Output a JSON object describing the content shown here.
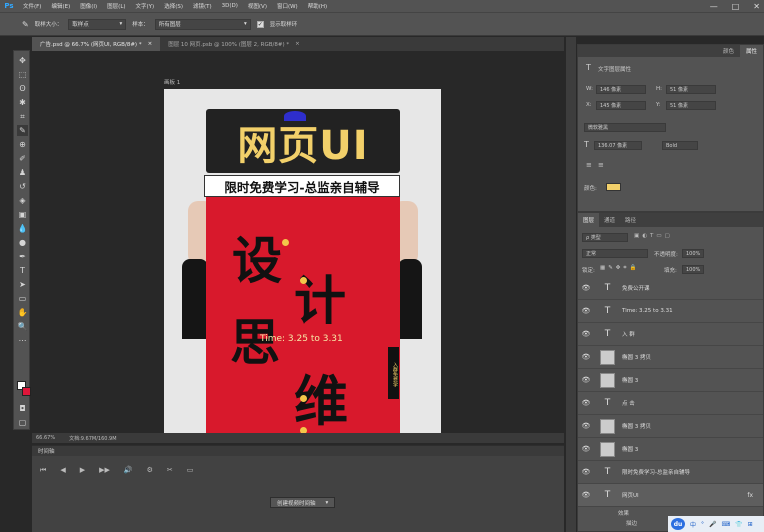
{
  "app": {
    "logo": "Ps",
    "menu": [
      "文件(F)",
      "编辑(E)",
      "图像(I)",
      "图层(L)",
      "文字(Y)",
      "选择(S)",
      "滤镜(T)",
      "3D(D)",
      "视图(V)",
      "窗口(W)",
      "帮助(H)"
    ],
    "window_controls": [
      "—",
      "□",
      "✕"
    ]
  },
  "options_bar": {
    "sample_size_label": "取样大小：",
    "sample_size_value": "取样点",
    "sample_label": "样本：",
    "sample_value": "所有图层",
    "show_ring_label": "显示取样环"
  },
  "tabs": [
    {
      "label": "广告.psd @ 66.7% (网页UI, RGB/8#) *",
      "close": "×"
    },
    {
      "label": "图层 10 网页.psb @ 100% (图层 2, RGB/8#) *",
      "close": "×"
    }
  ],
  "artboard_label": "画板 1",
  "poster": {
    "title": "网页UI",
    "subtitle": "限时免费学习-总监亲自辅导",
    "chars": [
      "设",
      "计",
      "思",
      "维"
    ],
    "time_text": "Time: 3.25 to 3.31",
    "vertical_tag": "入群免费学"
  },
  "status": {
    "zoom": "66.67%",
    "doc": "文档:9.67M/160.9M"
  },
  "timeline": {
    "header": "时间轴",
    "controls": [
      "⏮",
      "◀",
      "▶",
      "▶▶",
      "🔊",
      "⚙",
      "✂",
      "▭"
    ],
    "create_button": "创建视频时间轴",
    "create_dropdown": "▾"
  },
  "properties": {
    "tabs": [
      "颜色",
      "属性"
    ],
    "section": "文字图层属性",
    "w_label": "W:",
    "w_value": "146 像素",
    "h_label": "H:",
    "h_value": "51 像素",
    "x_label": "X:",
    "x_value": "145 像素",
    "y_label": "Y:",
    "y_value": "51 像素",
    "font": "微软雅黑",
    "size": "136.07 像素",
    "weight": "Bold",
    "color_label": "颜色:",
    "color_value": "#f2d06a"
  },
  "layers": {
    "tabs": [
      "图层",
      "通道",
      "路径"
    ],
    "filter_label": "ρ 类型",
    "blend_mode": "正常",
    "opacity_label": "不透明度:",
    "opacity_value": "100%",
    "lock_label": "锁定:",
    "fill_label": "填充:",
    "fill_value": "100%",
    "items": [
      {
        "kind": "text",
        "name": "免费公开课"
      },
      {
        "kind": "text",
        "name": "Time: 3.25 to 3.31"
      },
      {
        "kind": "text",
        "name": "入 群"
      },
      {
        "kind": "img",
        "name": "椭圆 3 拷贝"
      },
      {
        "kind": "img",
        "name": "椭圆 3"
      },
      {
        "kind": "text",
        "name": "点 击"
      },
      {
        "kind": "img",
        "name": "椭圆 3 拷贝"
      },
      {
        "kind": "img",
        "name": "椭圆 3"
      },
      {
        "kind": "text",
        "name": "限时免费学习-总监亲自辅导"
      },
      {
        "kind": "text",
        "name": "网页UI"
      }
    ],
    "effects_label": "效果",
    "effect_item": "描边",
    "fx": "fx"
  },
  "tray": {
    "logo": "du",
    "items": [
      "中",
      "°",
      "🎤",
      "⌨",
      "👕",
      "⊞"
    ]
  }
}
